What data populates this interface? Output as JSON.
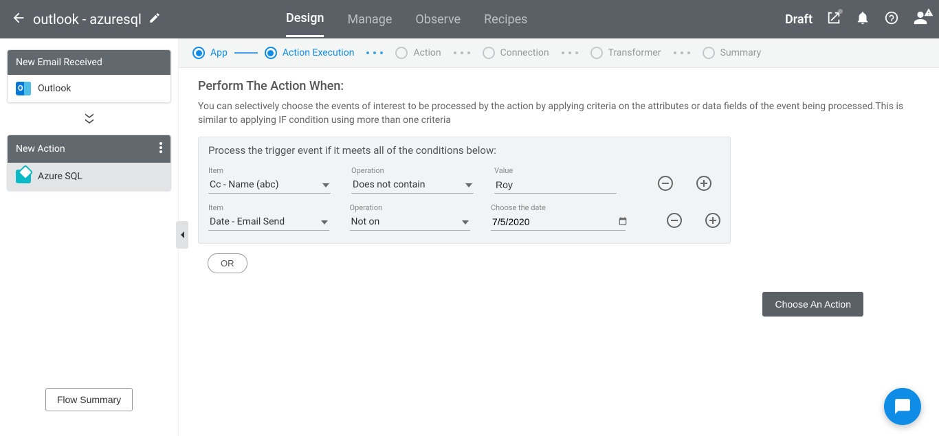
{
  "header": {
    "title": "outlook - azuresql",
    "tabs": [
      {
        "label": "Design",
        "active": true
      },
      {
        "label": "Manage",
        "active": false
      },
      {
        "label": "Observe",
        "active": false
      },
      {
        "label": "Recipes",
        "active": false
      }
    ],
    "status": "Draft"
  },
  "sidebar": {
    "trigger_card": {
      "header": "New Email Received",
      "app": "Outlook"
    },
    "action_card": {
      "header": "New Action",
      "app": "Azure SQL"
    },
    "flow_summary_label": "Flow Summary"
  },
  "stepper": [
    {
      "label": "App",
      "state": "active"
    },
    {
      "label": "Action Execution",
      "state": "active"
    },
    {
      "label": "Action",
      "state": "future"
    },
    {
      "label": "Connection",
      "state": "future"
    },
    {
      "label": "Transformer",
      "state": "future"
    },
    {
      "label": "Summary",
      "state": "future"
    }
  ],
  "content": {
    "heading": "Perform The Action When:",
    "description": "You can selectively choose the events of interest to be processed by the action by applying criteria on the attributes or data fields of the event being processed.This is similar to applying IF condition using more than one criteria",
    "conditions_title": "Process the trigger event if it meets all of the conditions below:",
    "rows": [
      {
        "item_label": "Item",
        "item_value": "Cc - Name (abc)",
        "op_label": "Operation",
        "op_value": "Does not contain",
        "val_label": "Value",
        "val_value": "Roy",
        "type": "text"
      },
      {
        "item_label": "Item",
        "item_value": "Date - Email Send",
        "op_label": "Operation",
        "op_value": "Not on",
        "val_label": "Choose the date",
        "val_value": "7/5/2020",
        "type": "date"
      }
    ],
    "or_label": "OR",
    "choose_action_label": "Choose An Action"
  }
}
